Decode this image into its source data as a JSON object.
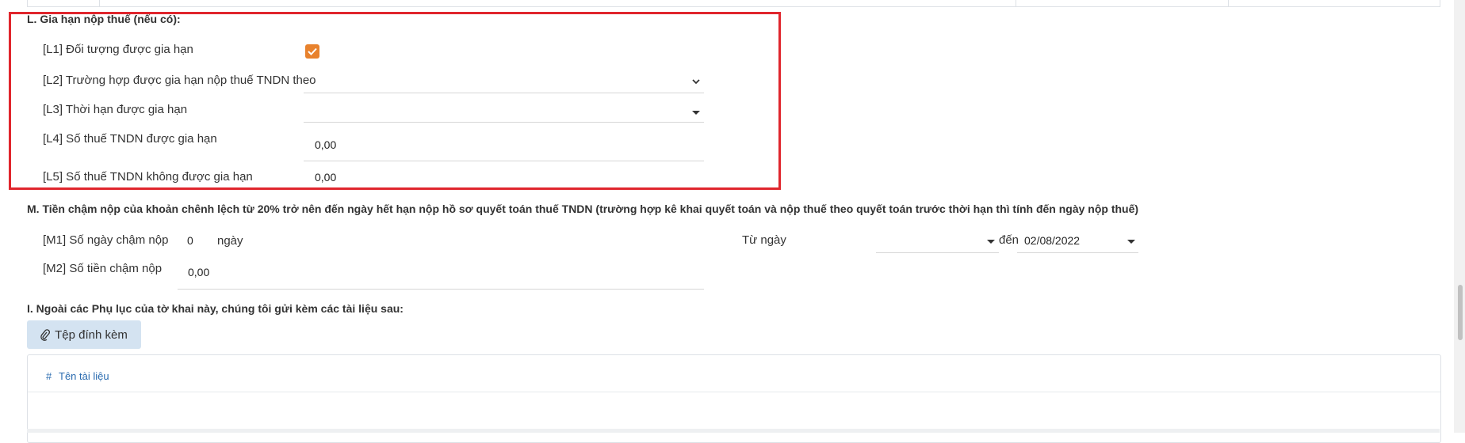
{
  "section_l": {
    "title": "L. Gia hạn nộp thuế (nếu có):",
    "l1_label": "[L1] Đối tượng được gia hạn",
    "l1_checked": true,
    "l2_label": "[L2] Trường hợp được gia hạn nộp thuế TNDN theo",
    "l2_value": "",
    "l3_label": "[L3] Thời hạn được gia hạn",
    "l3_value": "",
    "l4_label": "[L4] Số thuế TNDN được gia hạn",
    "l4_value": "0,00",
    "l5_label": "[L5] Số thuế TNDN không được gia hạn",
    "l5_value": "0,00"
  },
  "section_m": {
    "title": "M. Tiền chậm nộp của khoản chênh lệch từ 20% trở nên đến ngày hết hạn nộp hồ sơ quyết toán thuế TNDN (trường hợp kê khai quyết toán và nộp thuế theo quyết toán trước thời hạn thì tính đến ngày nộp thuế)",
    "m1_label": "[M1] Số ngày chậm nộp",
    "m1_value": "0",
    "m1_unit": "ngày",
    "from_label": "Từ ngày",
    "from_value": "",
    "to_label": "đến",
    "to_value": "02/08/2022",
    "m2_label": "[M2] Số tiền chậm nộp",
    "m2_value": "0,00"
  },
  "section_i": {
    "title": "I. Ngoài các Phụ lục của tờ khai này, chúng tôi gửi kèm các tài liệu sau:",
    "attach_label": "Tệp đính kèm",
    "table_col_index": "#",
    "table_col_name": "Tên tài liệu"
  },
  "colors": {
    "highlight_border": "#e0262d",
    "checkbox": "#e8822d",
    "attach_button": "#d4e3f1",
    "link_blue": "#2b6cb0"
  },
  "icons": {
    "checkbox": "check-icon",
    "dropdown": "caret-down-icon",
    "attachment": "paperclip-icon"
  }
}
